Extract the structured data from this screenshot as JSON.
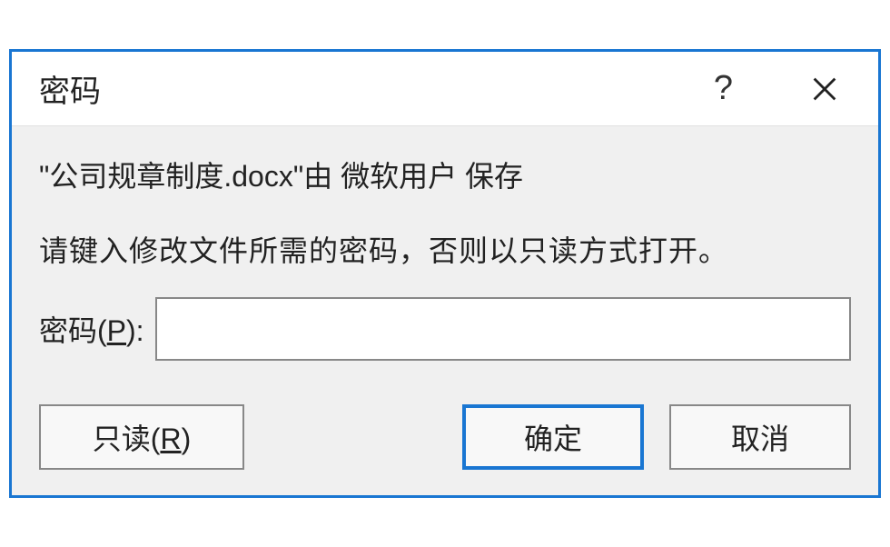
{
  "dialog": {
    "title": "密码",
    "info_text": "\"公司规章制度.docx\"由 微软用户 保存",
    "prompt_text": "请键入修改文件所需的密码，否则以只读方式打开。",
    "password_label_prefix": "密码(",
    "password_label_hotkey": "P",
    "password_label_suffix": "):",
    "password_value": "",
    "buttons": {
      "readonly_prefix": "只读(",
      "readonly_hotkey": "R",
      "readonly_suffix": ")",
      "ok": "确定",
      "cancel": "取消"
    }
  }
}
